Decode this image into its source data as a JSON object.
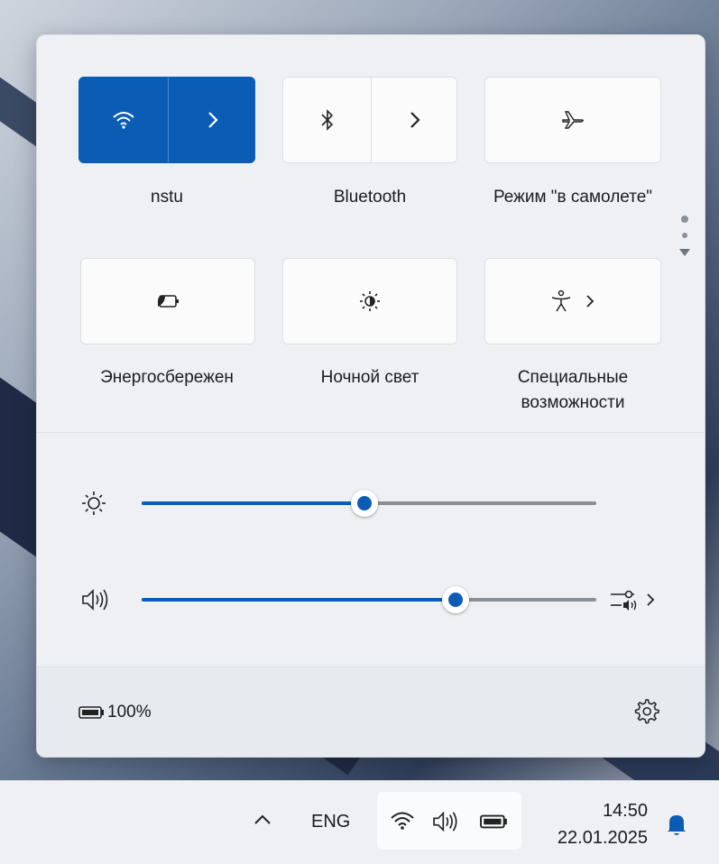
{
  "quick_settings": {
    "tiles": [
      {
        "id": "wifi",
        "label": "nstu",
        "icon": "wifi-icon",
        "active": true,
        "has_arrow": true
      },
      {
        "id": "bluetooth",
        "label": "Bluetooth",
        "icon": "bluetooth-icon",
        "active": false,
        "has_arrow": true
      },
      {
        "id": "airplane",
        "label": "Режим \"в самолете\"",
        "icon": "airplane-icon",
        "active": false,
        "has_arrow": false
      },
      {
        "id": "battery_saver",
        "label": "Энергосбережен",
        "icon": "battery-saver-icon",
        "active": false,
        "has_arrow": false
      },
      {
        "id": "night_light",
        "label": "Ночной свет",
        "icon": "night-light-icon",
        "active": false,
        "has_arrow": false
      },
      {
        "id": "accessibility",
        "label": "Специальные возможности",
        "icon": "accessibility-icon",
        "active": false,
        "has_arrow": true
      }
    ],
    "arrow_glyph": ">",
    "brightness": {
      "value": 0.49,
      "icon": "brightness-icon"
    },
    "volume": {
      "value": 0.69,
      "icon": "speaker-icon",
      "mixer_icon": "audio-mixer-icon"
    },
    "battery_text": "100%",
    "settings_icon": "gear-icon"
  },
  "taskbar": {
    "chevron": "^",
    "language": "ENG",
    "tray_icons": [
      "wifi-icon",
      "speaker-icon",
      "battery-icon"
    ],
    "time": "14:50",
    "date": "22.01.2025",
    "notification_icon": "bell-icon"
  },
  "colors": {
    "accent": "#0b5cb5",
    "panel": "#eef0f4",
    "taskbar": "#eef0f3"
  }
}
